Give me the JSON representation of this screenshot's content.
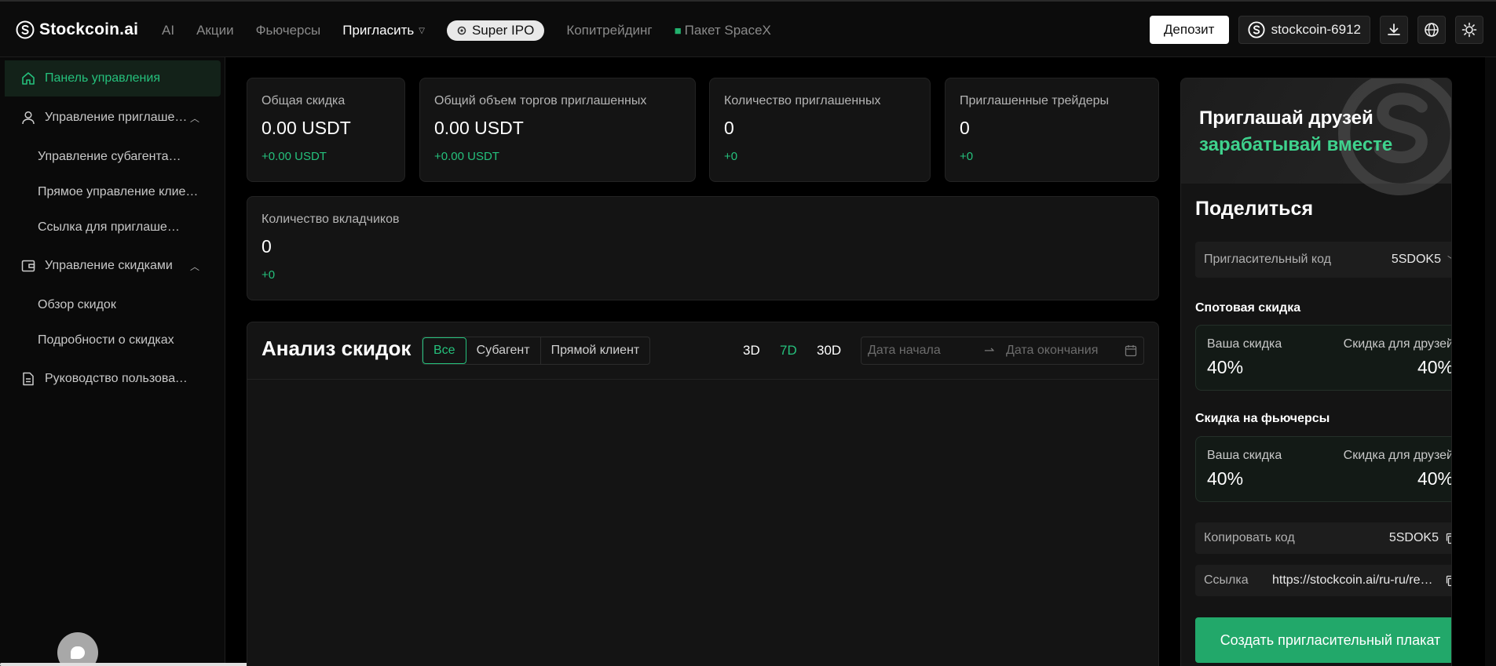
{
  "brand": {
    "name": "Stockcoin.ai",
    "accent": "#25c07c"
  },
  "nav": {
    "items": [
      {
        "label": "AI"
      },
      {
        "label": "Акции"
      },
      {
        "label": "Фьючерсы"
      },
      {
        "label": "Пригласить"
      },
      {
        "label": "Super IPO"
      },
      {
        "label": "Копитрейдинг"
      },
      {
        "label": "Пакет SpaceX"
      }
    ]
  },
  "header": {
    "deposit_label": "Депозит",
    "account_label": "stockcoin-6912"
  },
  "sidebar": {
    "items": [
      {
        "label": "Панель управления",
        "icon": "home-icon"
      },
      {
        "label": "Управление приглашениями",
        "icon": "user-icon"
      },
      {
        "label": "Управление субагентами"
      },
      {
        "label": "Прямое управление клиентами"
      },
      {
        "label": "Ссылка для приглашения"
      },
      {
        "label": "Управление скидками",
        "icon": "wallet-icon"
      },
      {
        "label": "Обзор скидок"
      },
      {
        "label": "Подробности о скидках"
      },
      {
        "label": "Руководство пользователя",
        "icon": "document-icon"
      }
    ]
  },
  "stats": [
    {
      "label": "Общая скидка",
      "value": "0.00 USDT",
      "delta": "+0.00 USDT"
    },
    {
      "label": "Общий объем торгов приглашенных",
      "value": "0.00 USDT",
      "delta": "+0.00 USDT"
    },
    {
      "label": "Количество приглашенных",
      "value": "0",
      "delta": "+0"
    },
    {
      "label": "Приглашенные трейдеры",
      "value": "0",
      "delta": "+0"
    },
    {
      "label": "Количество вкладчиков",
      "value": "0",
      "delta": "+0"
    }
  ],
  "analysis": {
    "title": "Анализ скидок",
    "segments": [
      "Все",
      "Субагент",
      "Прямой клиент"
    ],
    "periods": [
      "3D",
      "7D",
      "30D"
    ],
    "date_start_placeholder": "Дата начала",
    "date_end_placeholder": "Дата окончания"
  },
  "share": {
    "banner_line1": "Приглашай друзей",
    "banner_line2": "зарабатывай вместе",
    "title": "Поделиться",
    "invite_code_label": "Пригласительный код",
    "invite_code_value": "5SDOK5",
    "spot_title": "Спотовая скидка",
    "futures_title": "Скидка на фьючерсы",
    "your_discount_label": "Ваша скидка",
    "friend_discount_label": "Скидка для друзей",
    "spot_your": "40%",
    "spot_friend": "40%",
    "futures_your": "40%",
    "futures_friend": "40%",
    "copy_code_label": "Копировать код",
    "copy_code_value": "5SDOK5",
    "link_label": "Ссылка",
    "link_value": "https://stockcoin.ai/ru-ru/register",
    "poster_button": "Создать пригласительный плакат"
  }
}
